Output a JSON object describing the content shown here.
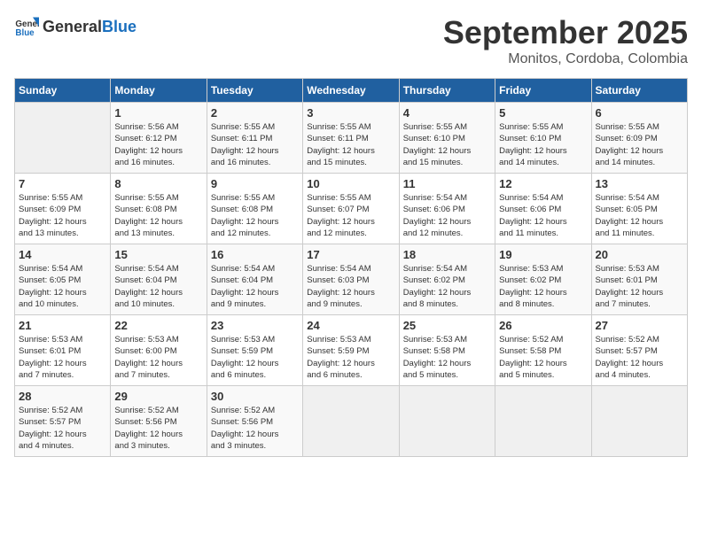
{
  "header": {
    "logo_general": "General",
    "logo_blue": "Blue",
    "month": "September 2025",
    "location": "Monitos, Cordoba, Colombia"
  },
  "days_of_week": [
    "Sunday",
    "Monday",
    "Tuesday",
    "Wednesday",
    "Thursday",
    "Friday",
    "Saturday"
  ],
  "weeks": [
    [
      {
        "day": "",
        "info": ""
      },
      {
        "day": "1",
        "info": "Sunrise: 5:56 AM\nSunset: 6:12 PM\nDaylight: 12 hours\nand 16 minutes."
      },
      {
        "day": "2",
        "info": "Sunrise: 5:55 AM\nSunset: 6:11 PM\nDaylight: 12 hours\nand 16 minutes."
      },
      {
        "day": "3",
        "info": "Sunrise: 5:55 AM\nSunset: 6:11 PM\nDaylight: 12 hours\nand 15 minutes."
      },
      {
        "day": "4",
        "info": "Sunrise: 5:55 AM\nSunset: 6:10 PM\nDaylight: 12 hours\nand 15 minutes."
      },
      {
        "day": "5",
        "info": "Sunrise: 5:55 AM\nSunset: 6:10 PM\nDaylight: 12 hours\nand 14 minutes."
      },
      {
        "day": "6",
        "info": "Sunrise: 5:55 AM\nSunset: 6:09 PM\nDaylight: 12 hours\nand 14 minutes."
      }
    ],
    [
      {
        "day": "7",
        "info": "Sunrise: 5:55 AM\nSunset: 6:09 PM\nDaylight: 12 hours\nand 13 minutes."
      },
      {
        "day": "8",
        "info": "Sunrise: 5:55 AM\nSunset: 6:08 PM\nDaylight: 12 hours\nand 13 minutes."
      },
      {
        "day": "9",
        "info": "Sunrise: 5:55 AM\nSunset: 6:08 PM\nDaylight: 12 hours\nand 12 minutes."
      },
      {
        "day": "10",
        "info": "Sunrise: 5:55 AM\nSunset: 6:07 PM\nDaylight: 12 hours\nand 12 minutes."
      },
      {
        "day": "11",
        "info": "Sunrise: 5:54 AM\nSunset: 6:06 PM\nDaylight: 12 hours\nand 12 minutes."
      },
      {
        "day": "12",
        "info": "Sunrise: 5:54 AM\nSunset: 6:06 PM\nDaylight: 12 hours\nand 11 minutes."
      },
      {
        "day": "13",
        "info": "Sunrise: 5:54 AM\nSunset: 6:05 PM\nDaylight: 12 hours\nand 11 minutes."
      }
    ],
    [
      {
        "day": "14",
        "info": "Sunrise: 5:54 AM\nSunset: 6:05 PM\nDaylight: 12 hours\nand 10 minutes."
      },
      {
        "day": "15",
        "info": "Sunrise: 5:54 AM\nSunset: 6:04 PM\nDaylight: 12 hours\nand 10 minutes."
      },
      {
        "day": "16",
        "info": "Sunrise: 5:54 AM\nSunset: 6:04 PM\nDaylight: 12 hours\nand 9 minutes."
      },
      {
        "day": "17",
        "info": "Sunrise: 5:54 AM\nSunset: 6:03 PM\nDaylight: 12 hours\nand 9 minutes."
      },
      {
        "day": "18",
        "info": "Sunrise: 5:54 AM\nSunset: 6:02 PM\nDaylight: 12 hours\nand 8 minutes."
      },
      {
        "day": "19",
        "info": "Sunrise: 5:53 AM\nSunset: 6:02 PM\nDaylight: 12 hours\nand 8 minutes."
      },
      {
        "day": "20",
        "info": "Sunrise: 5:53 AM\nSunset: 6:01 PM\nDaylight: 12 hours\nand 7 minutes."
      }
    ],
    [
      {
        "day": "21",
        "info": "Sunrise: 5:53 AM\nSunset: 6:01 PM\nDaylight: 12 hours\nand 7 minutes."
      },
      {
        "day": "22",
        "info": "Sunrise: 5:53 AM\nSunset: 6:00 PM\nDaylight: 12 hours\nand 7 minutes."
      },
      {
        "day": "23",
        "info": "Sunrise: 5:53 AM\nSunset: 5:59 PM\nDaylight: 12 hours\nand 6 minutes."
      },
      {
        "day": "24",
        "info": "Sunrise: 5:53 AM\nSunset: 5:59 PM\nDaylight: 12 hours\nand 6 minutes."
      },
      {
        "day": "25",
        "info": "Sunrise: 5:53 AM\nSunset: 5:58 PM\nDaylight: 12 hours\nand 5 minutes."
      },
      {
        "day": "26",
        "info": "Sunrise: 5:52 AM\nSunset: 5:58 PM\nDaylight: 12 hours\nand 5 minutes."
      },
      {
        "day": "27",
        "info": "Sunrise: 5:52 AM\nSunset: 5:57 PM\nDaylight: 12 hours\nand 4 minutes."
      }
    ],
    [
      {
        "day": "28",
        "info": "Sunrise: 5:52 AM\nSunset: 5:57 PM\nDaylight: 12 hours\nand 4 minutes."
      },
      {
        "day": "29",
        "info": "Sunrise: 5:52 AM\nSunset: 5:56 PM\nDaylight: 12 hours\nand 3 minutes."
      },
      {
        "day": "30",
        "info": "Sunrise: 5:52 AM\nSunset: 5:56 PM\nDaylight: 12 hours\nand 3 minutes."
      },
      {
        "day": "",
        "info": ""
      },
      {
        "day": "",
        "info": ""
      },
      {
        "day": "",
        "info": ""
      },
      {
        "day": "",
        "info": ""
      }
    ]
  ]
}
